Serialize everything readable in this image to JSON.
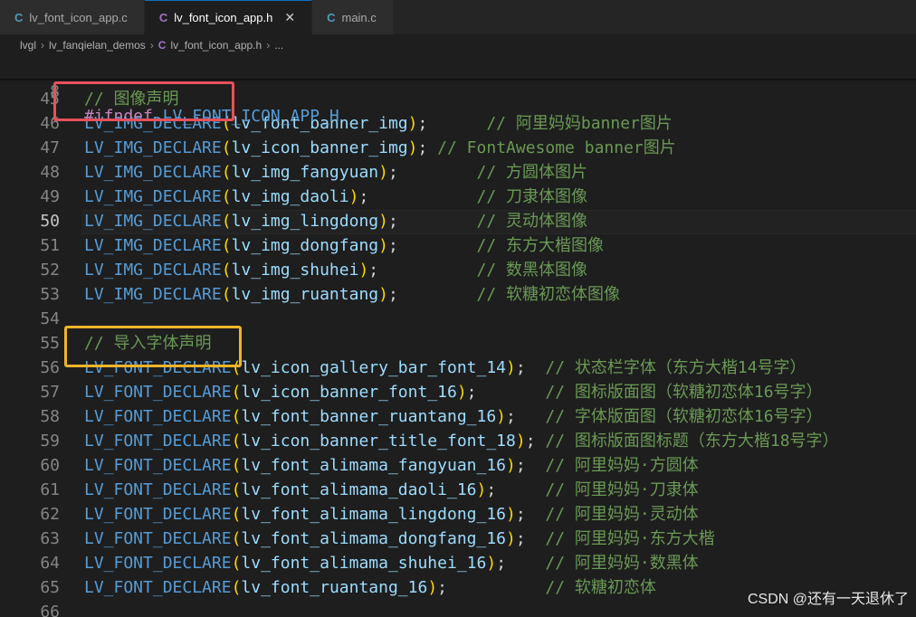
{
  "tabs": [
    {
      "icon": "C",
      "label": "lv_font_icon_app.c",
      "active": false,
      "closable": false
    },
    {
      "icon": "C",
      "label": "lv_font_icon_app.h",
      "active": true,
      "closable": true
    },
    {
      "icon": "C",
      "label": "main.c",
      "active": false,
      "closable": false
    }
  ],
  "breadcrumb": {
    "items": [
      "lvgl",
      "lv_fanqielan_demos"
    ],
    "file_icon": "C",
    "file": "lv_font_icon_app.h",
    "ellipsis": "..."
  },
  "sticky": {
    "line_no": "8",
    "directive": "#ifndef",
    "name": "LV_FONT_ICON_APP_H"
  },
  "current_line": "50",
  "lines": [
    {
      "no": "45",
      "comment": "// 图像声明"
    },
    {
      "no": "46",
      "macro": "LV_IMG_DECLARE",
      "arg": "lv_font_banner_img",
      "tail": ";      ",
      "comment": "// 阿里妈妈banner图片"
    },
    {
      "no": "47",
      "macro": "LV_IMG_DECLARE",
      "arg": "lv_icon_banner_img",
      "tail": "; ",
      "comment": "// FontAwesome banner图片"
    },
    {
      "no": "48",
      "macro": "LV_IMG_DECLARE",
      "arg": "lv_img_fangyuan",
      "tail": ";        ",
      "comment": "// 方圆体图片"
    },
    {
      "no": "49",
      "macro": "LV_IMG_DECLARE",
      "arg": "lv_img_daoli",
      "tail": ";           ",
      "comment": "// 刀隶体图像"
    },
    {
      "no": "50",
      "macro": "LV_IMG_DECLARE",
      "arg": "lv_img_lingdong",
      "tail": ";        ",
      "comment": "// 灵动体图像"
    },
    {
      "no": "51",
      "macro": "LV_IMG_DECLARE",
      "arg": "lv_img_dongfang",
      "tail": ";        ",
      "comment": "// 东方大楷图像"
    },
    {
      "no": "52",
      "macro": "LV_IMG_DECLARE",
      "arg": "lv_img_shuhei",
      "tail": ";          ",
      "comment": "// 数黑体图像"
    },
    {
      "no": "53",
      "macro": "LV_IMG_DECLARE",
      "arg": "lv_img_ruantang",
      "tail": ";        ",
      "comment": "// 软糖初恋体图像"
    },
    {
      "no": "54"
    },
    {
      "no": "55",
      "comment": "// 导入字体声明"
    },
    {
      "no": "56",
      "macro": "LV_FONT_DECLARE",
      "arg": "lv_icon_gallery_bar_font_14",
      "tail": ";  ",
      "comment": "// 状态栏字体（东方大楷14号字）"
    },
    {
      "no": "57",
      "macro": "LV_FONT_DECLARE",
      "arg": "lv_icon_banner_font_16",
      "tail": ";       ",
      "comment": "// 图标版面图（软糖初恋体16号字）"
    },
    {
      "no": "58",
      "macro": "LV_FONT_DECLARE",
      "arg": "lv_font_banner_ruantang_16",
      "tail": ";   ",
      "comment": "// 字体版面图（软糖初恋体16号字）"
    },
    {
      "no": "59",
      "macro": "LV_FONT_DECLARE",
      "arg": "lv_icon_banner_title_font_18",
      "tail": "; ",
      "comment": "// 图标版面图标题（东方大楷18号字）"
    },
    {
      "no": "60",
      "macro": "LV_FONT_DECLARE",
      "arg": "lv_font_alimama_fangyuan_16",
      "tail": ";  ",
      "comment": "// 阿里妈妈·方圆体"
    },
    {
      "no": "61",
      "macro": "LV_FONT_DECLARE",
      "arg": "lv_font_alimama_daoli_16",
      "tail": ";     ",
      "comment": "// 阿里妈妈·刀隶体"
    },
    {
      "no": "62",
      "macro": "LV_FONT_DECLARE",
      "arg": "lv_font_alimama_lingdong_16",
      "tail": ";  ",
      "comment": "// 阿里妈妈·灵动体"
    },
    {
      "no": "63",
      "macro": "LV_FONT_DECLARE",
      "arg": "lv_font_alimama_dongfang_16",
      "tail": ";  ",
      "comment": "// 阿里妈妈·东方大楷"
    },
    {
      "no": "64",
      "macro": "LV_FONT_DECLARE",
      "arg": "lv_font_alimama_shuhei_16",
      "tail": ";    ",
      "comment": "// 阿里妈妈·数黑体"
    },
    {
      "no": "65",
      "macro": "LV_FONT_DECLARE",
      "arg": "lv_font_ruantang_16",
      "tail": ";          ",
      "comment": "// 软糖初恋体"
    },
    {
      "no": "66"
    }
  ],
  "annotations": [
    {
      "line_no": "45",
      "color": "#e8505b"
    },
    {
      "line_no": "55",
      "color": "#f0b429"
    }
  ],
  "watermark": "CSDN @还有一天退休了"
}
